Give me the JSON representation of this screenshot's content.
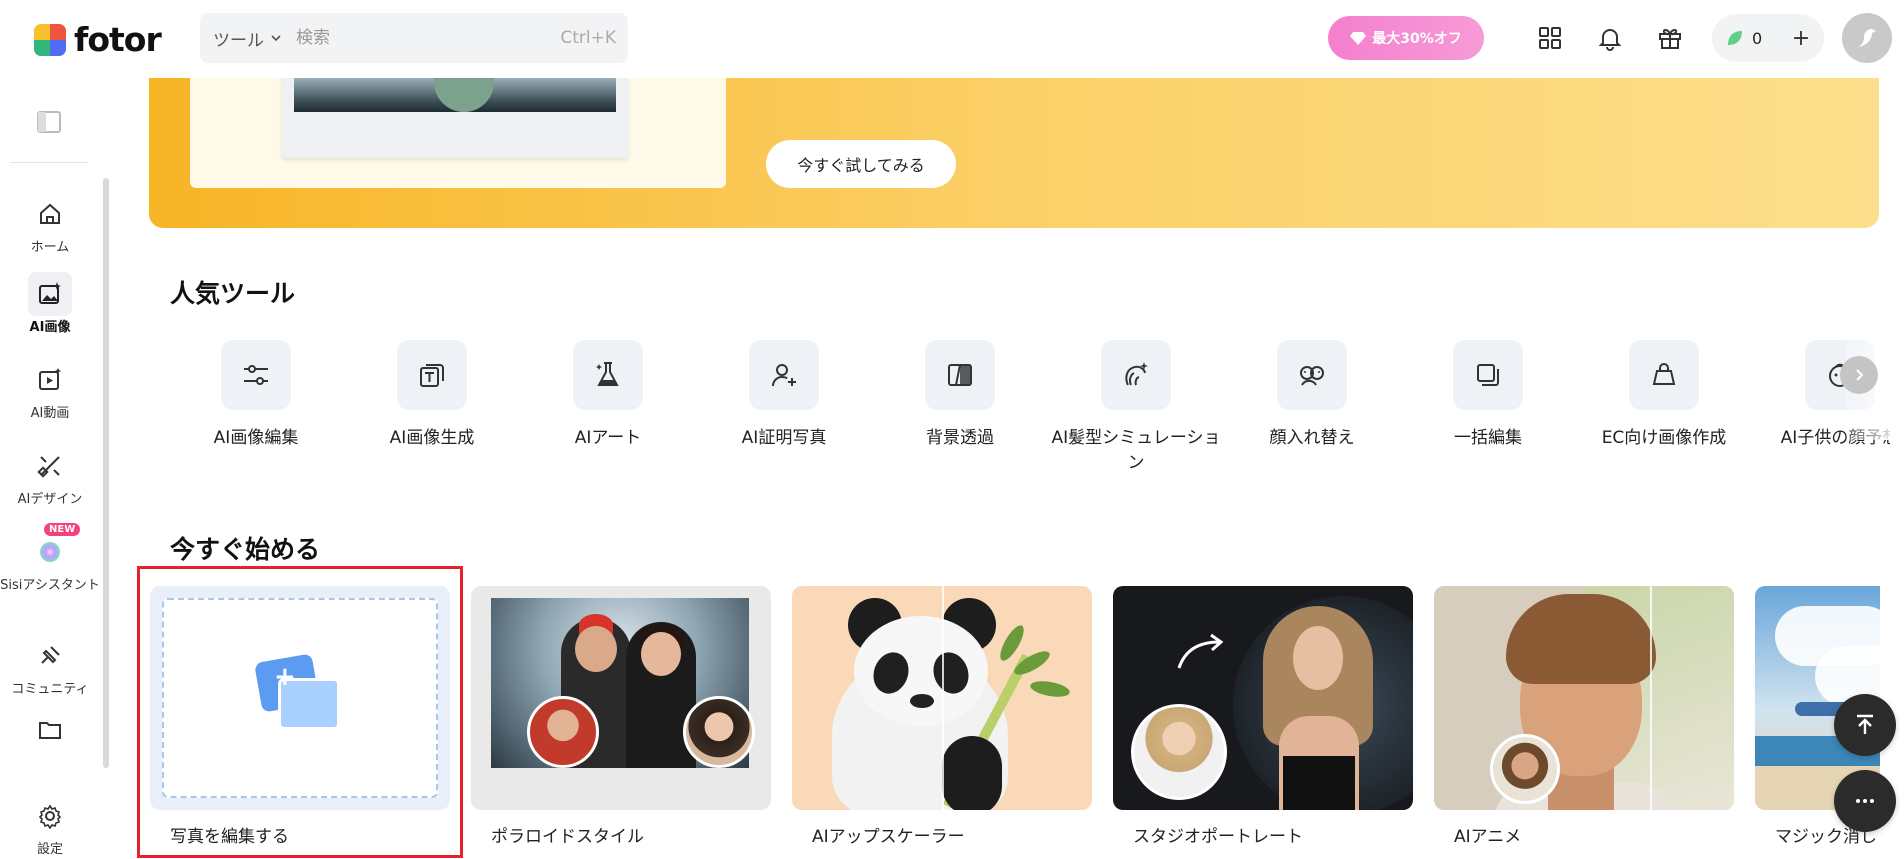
{
  "header": {
    "logo_text": "fotor",
    "search": {
      "tool_select": "ツール",
      "placeholder": "検索",
      "shortcut": "Ctrl+K"
    },
    "promo_label": "最大30%オフ",
    "credits": "0"
  },
  "sidebar": {
    "items": [
      {
        "label": "ホーム",
        "icon": "home-icon"
      },
      {
        "label": "AI画像",
        "icon": "ai-image-icon",
        "active": true
      },
      {
        "label": "AI動画",
        "icon": "ai-video-icon"
      },
      {
        "label": "AIデザイン",
        "icon": "ai-design-icon"
      },
      {
        "label": "Sisiアシスタント",
        "icon": "sisi-assistant-icon",
        "badge": "NEW"
      },
      {
        "label": "コミュニティ",
        "icon": "community-icon"
      },
      {
        "label": "設定",
        "icon": "settings-icon"
      }
    ]
  },
  "banner": {
    "cta_label": "今すぐ試してみる"
  },
  "popular_tools": {
    "title": "人気ツール",
    "items": [
      {
        "label": "AI画像編集",
        "icon": "sliders-icon"
      },
      {
        "label": "AI画像生成",
        "icon": "text-to-image-icon"
      },
      {
        "label": "AIアート",
        "icon": "flask-icon"
      },
      {
        "label": "AI証明写真",
        "icon": "id-photo-icon"
      },
      {
        "label": "背景透過",
        "icon": "background-remover-icon"
      },
      {
        "label": "AI髪型シミュレーション",
        "icon": "hairstyle-icon"
      },
      {
        "label": "顔入れ替え",
        "icon": "face-swap-icon"
      },
      {
        "label": "一括編集",
        "icon": "batch-edit-icon"
      },
      {
        "label": "EC向け画像作成",
        "icon": "shopping-bag-icon"
      },
      {
        "label": "AI子供の顔予想",
        "icon": "baby-face-icon"
      }
    ]
  },
  "get_started": {
    "title": "今すぐ始める",
    "cards": [
      {
        "label": "写真を編集する"
      },
      {
        "label": "ポラロイドスタイル"
      },
      {
        "label": "AIアップスケーラー"
      },
      {
        "label": "スタジオポートレート"
      },
      {
        "label": "AIアニメ"
      },
      {
        "label": "マジック消し"
      }
    ]
  },
  "colors": {
    "accent_pink": "#f47fcd",
    "banner_yellow": "#f7b526",
    "highlight_red": "#e5202b",
    "tool_tile_bg": "#eef2f7"
  }
}
